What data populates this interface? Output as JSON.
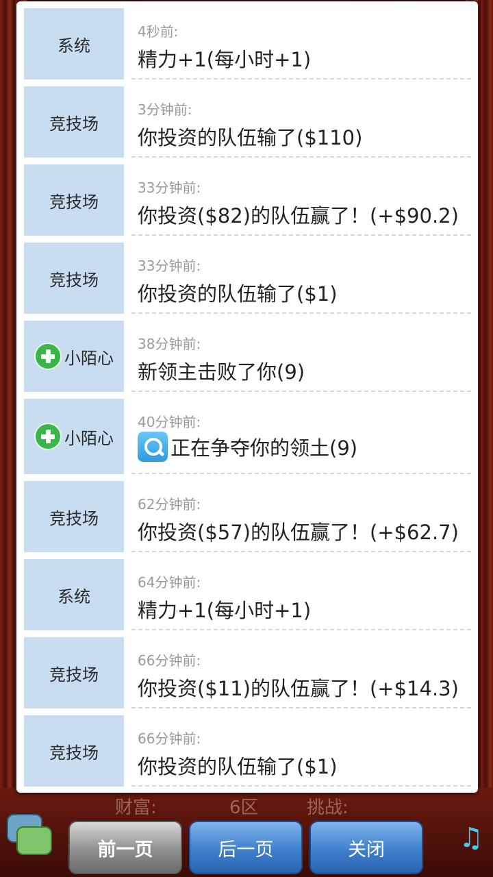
{
  "messages": [
    {
      "tag": "系统",
      "time": "4秒前:",
      "text": "精力+1(每小时+1)",
      "tag_icon": "",
      "msg_icon": ""
    },
    {
      "tag": "竞技场",
      "time": "3分钟前:",
      "text": "你投资的队伍输了($110)",
      "tag_icon": "",
      "msg_icon": ""
    },
    {
      "tag": "竞技场",
      "time": "33分钟前:",
      "text": "你投资($82)的队伍赢了！(+$90.2)",
      "tag_icon": "",
      "msg_icon": ""
    },
    {
      "tag": "竞技场",
      "time": "33分钟前:",
      "text": "你投资的队伍输了($1)",
      "tag_icon": "",
      "msg_icon": ""
    },
    {
      "tag": "小陌心",
      "time": "38分钟前:",
      "text": "新领主击败了你(9)",
      "tag_icon": "plus-icon",
      "msg_icon": ""
    },
    {
      "tag": "小陌心",
      "time": "40分钟前:",
      "text": "正在争夺你的领土(9)",
      "tag_icon": "plus-icon",
      "msg_icon": "search-icon"
    },
    {
      "tag": "竞技场",
      "time": "62分钟前:",
      "text": "你投资($57)的队伍赢了！(+$62.7)",
      "tag_icon": "",
      "msg_icon": ""
    },
    {
      "tag": "系统",
      "time": "64分钟前:",
      "text": "精力+1(每小时+1)",
      "tag_icon": "",
      "msg_icon": ""
    },
    {
      "tag": "竞技场",
      "time": "66分钟前:",
      "text": "你投资($11)的队伍赢了！(+$14.3)",
      "tag_icon": "",
      "msg_icon": ""
    },
    {
      "tag": "竞技场",
      "time": "66分钟前:",
      "text": "你投资的队伍输了($1)",
      "tag_icon": "",
      "msg_icon": ""
    }
  ],
  "buttons": {
    "prev": "前一页",
    "next": "后一页",
    "close": "关闭"
  },
  "background_hud": {
    "wealth": "财富:",
    "zone": "6区",
    "challenge": "挑战:"
  },
  "colors": {
    "tag_bg": "#c9ddf0",
    "button_blue": "#3f7fcc",
    "button_gray": "#8e8e8e"
  }
}
